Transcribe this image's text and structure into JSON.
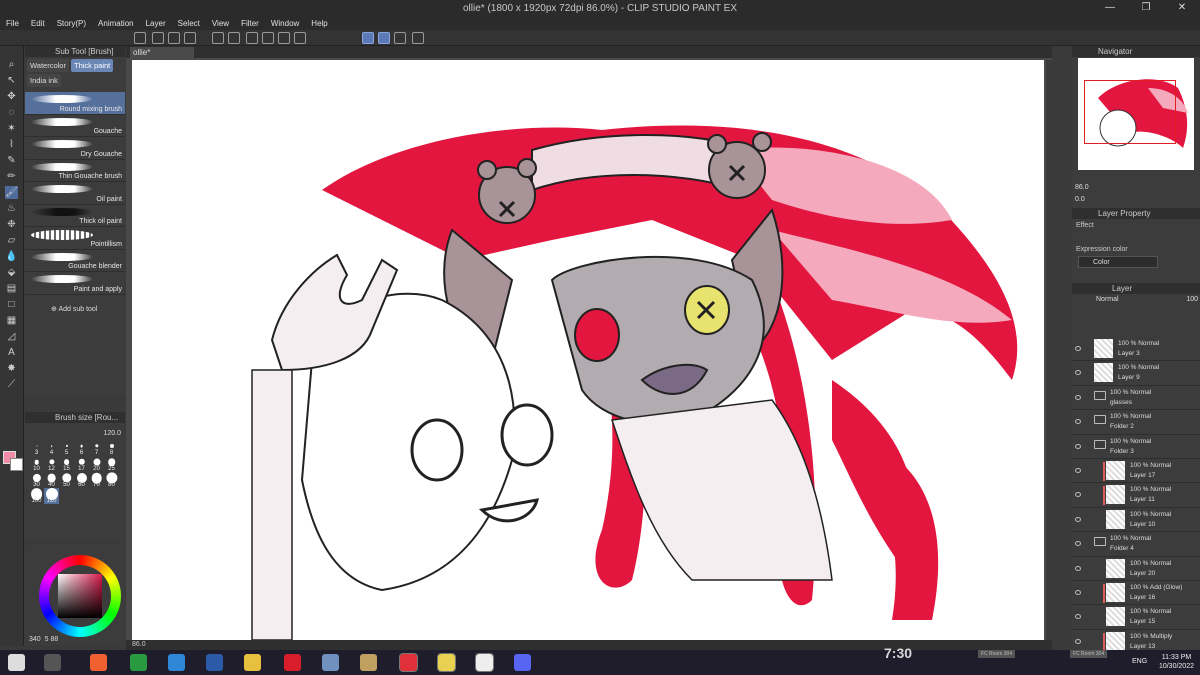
{
  "window": {
    "title": "ollie* (1800 x 1920px 72dpi 86.0%) - CLIP STUDIO PAINT EX",
    "controls": [
      "—",
      "❐",
      "✕"
    ]
  },
  "menu": [
    "File",
    "Edit",
    "Story(P)",
    "Animation",
    "Layer",
    "Select",
    "View",
    "Filter",
    "Window",
    "Help"
  ],
  "subtool": {
    "header": "Sub Tool [Brush]",
    "tabs": [
      "Watercolor",
      "Thick paint",
      "India ink"
    ],
    "active_tab": "Thick paint",
    "brushes": [
      "Round mixing brush",
      "Gouache",
      "Dry Gouache",
      "Thin Gouache brush",
      "Oil paint",
      "Thick oil paint",
      "Pointillism",
      "Gouache blender",
      "Paint and apply"
    ],
    "selected_brush": "Round mixing brush",
    "add_label": "Add sub tool"
  },
  "brush_size": {
    "header": "Brush size [Rou...",
    "value": "120.0",
    "presets": [
      "3",
      "4",
      "5",
      "6",
      "7",
      "8",
      "10",
      "12",
      "15",
      "17",
      "20",
      "25",
      "30",
      "40",
      "50",
      "60",
      "70",
      "80",
      "100",
      "120"
    ],
    "selected": "120"
  },
  "colors": {
    "main": "#f08ca8",
    "sub": "#ffffff",
    "hue": "#d81a4c",
    "readout": "340",
    "readout2": "5",
    "readout3": "88"
  },
  "document": {
    "tab": "ollie*",
    "zoom": "86.0",
    "status": "86.0"
  },
  "navigator": {
    "header": "Navigator",
    "zoom": "86.0",
    "rotate": "0.0"
  },
  "layer_property": {
    "header": "Layer Property",
    "effect_label": "Effect",
    "expr_label": "Expression color",
    "expr_value": "Color"
  },
  "layer_panel": {
    "header": "Layer",
    "blend_mode": "Normal",
    "opacity": "100",
    "layers": [
      {
        "mode": "100 % Normal",
        "name": "Layer 3",
        "type": "layer",
        "indent": 0,
        "clip": false
      },
      {
        "mode": "100 % Normal",
        "name": "Layer 9",
        "type": "layer",
        "indent": 0,
        "clip": false
      },
      {
        "mode": "100 % Normal",
        "name": "glasses",
        "type": "folder",
        "indent": 0,
        "clip": false
      },
      {
        "mode": "100 % Normal",
        "name": "Folder 2",
        "type": "folder",
        "indent": 0,
        "clip": false
      },
      {
        "mode": "100 % Normal",
        "name": "Folder 3",
        "type": "folder",
        "indent": 0,
        "clip": false
      },
      {
        "mode": "100 % Normal",
        "name": "Layer 17",
        "type": "layer",
        "indent": 1,
        "clip": true
      },
      {
        "mode": "100 % Normal",
        "name": "Layer 11",
        "type": "layer",
        "indent": 1,
        "clip": true
      },
      {
        "mode": "100 % Normal",
        "name": "Layer 10",
        "type": "layer",
        "indent": 1,
        "clip": false
      },
      {
        "mode": "100 % Normal",
        "name": "Folder 4",
        "type": "folder",
        "indent": 0,
        "clip": false
      },
      {
        "mode": "100 % Normal",
        "name": "Layer 20",
        "type": "layer",
        "indent": 1,
        "clip": false
      },
      {
        "mode": "100 % Add (Glow)",
        "name": "Layer 16",
        "type": "layer",
        "indent": 1,
        "clip": true
      },
      {
        "mode": "100 % Normal",
        "name": "Layer 15",
        "type": "layer",
        "indent": 1,
        "clip": false
      },
      {
        "mode": "100 % Multiply",
        "name": "Layer 13",
        "type": "layer",
        "indent": 1,
        "clip": true
      }
    ]
  },
  "taskbar": {
    "clock_widget": "7:30",
    "lang": "ENG",
    "time": "11:33 PM",
    "date": "10/30/2022",
    "ghost_label1": "FC Room 304",
    "ghost_label2": "FC Room 304",
    "apps": [
      "windows-start",
      "keyboard",
      "brave",
      "spreadsheet",
      "edge",
      "word",
      "file-explorer",
      "opera",
      "photos",
      "paint",
      "opera-gx",
      "sticky",
      "clip-studio",
      "discord"
    ]
  }
}
